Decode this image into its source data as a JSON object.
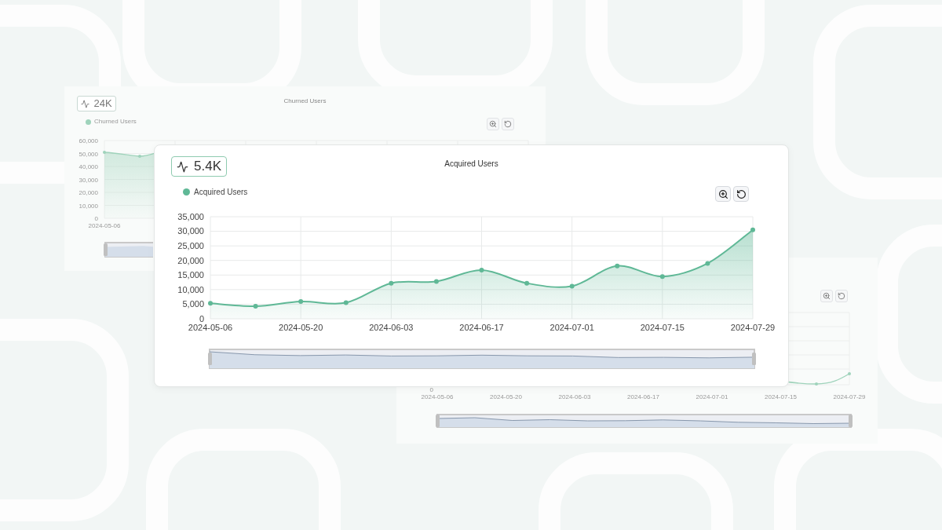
{
  "churned_card": {
    "stat": "24K",
    "title": "Churned Users",
    "legend": "Churned Users",
    "y_labels": [
      "60,000",
      "50,000",
      "40,000",
      "30,000",
      "20,000",
      "10,000",
      "0"
    ],
    "x_label": "2024-05-06"
  },
  "acquired_card": {
    "stat": "5.4K",
    "title": "Acquired Users",
    "chart_data": {
      "type": "area",
      "grid": true,
      "ylim": [
        0,
        35000
      ],
      "yticks": [
        {
          "value": 0,
          "label": "0"
        },
        {
          "value": 5000,
          "label": "5,000"
        },
        {
          "value": 10000,
          "label": "10,000"
        },
        {
          "value": 15000,
          "label": "15,000"
        },
        {
          "value": 20000,
          "label": "20,000"
        },
        {
          "value": 25000,
          "label": "25,000"
        },
        {
          "value": 30000,
          "label": "30,000"
        },
        {
          "value": 35000,
          "label": "35,000"
        }
      ],
      "categories": [
        "2024-05-06",
        null,
        "2024-05-20",
        null,
        "2024-06-03",
        null,
        "2024-06-17",
        null,
        "2024-07-01",
        null,
        "2024-07-15",
        null,
        "2024-07-29"
      ],
      "series": [
        {
          "name": "Acquired Users",
          "color": "#5fb896",
          "values": [
            5300,
            4300,
            5900,
            5500,
            12200,
            12800,
            16700,
            12200,
            11200,
            18100,
            14500,
            19000,
            30500
          ]
        }
      ]
    }
  },
  "back_card": {
    "y_tick": "0",
    "x_labels": [
      "2024-05-06",
      "2024-05-20",
      "2024-06-03",
      "2024-06-17",
      "2024-07-01",
      "2024-07-15",
      "2024-07-29"
    ]
  }
}
